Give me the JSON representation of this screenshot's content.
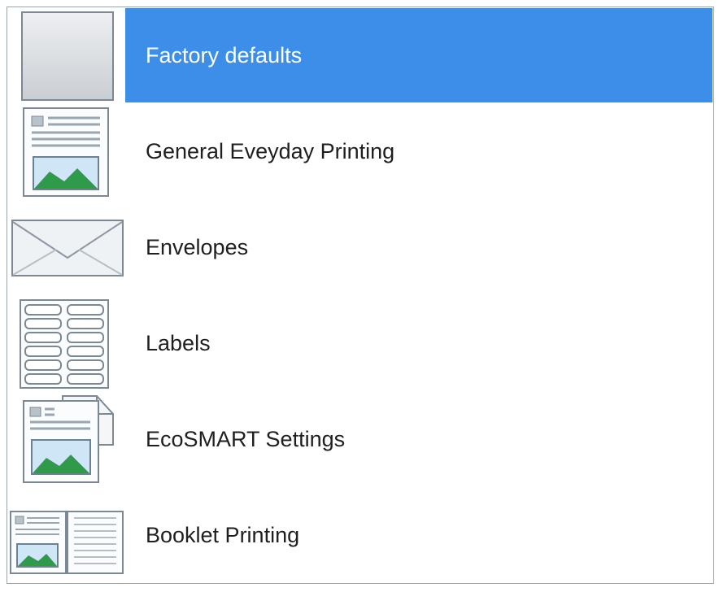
{
  "profiles": [
    {
      "label": "Factory defaults",
      "icon": "blank-page-icon",
      "selected": true
    },
    {
      "label": "General Eveyday Printing",
      "icon": "page-with-image-icon",
      "selected": false
    },
    {
      "label": "Envelopes",
      "icon": "envelope-icon",
      "selected": false
    },
    {
      "label": "Labels",
      "icon": "labels-sheet-icon",
      "selected": false
    },
    {
      "label": "EcoSMART Settings",
      "icon": "eco-pages-icon",
      "selected": false
    },
    {
      "label": "Booklet Printing",
      "icon": "booklet-icon",
      "selected": false
    }
  ],
  "colors": {
    "selection": "#3d8ee8",
    "text": "#1f1f1f",
    "selected_text": "#ffffff"
  }
}
